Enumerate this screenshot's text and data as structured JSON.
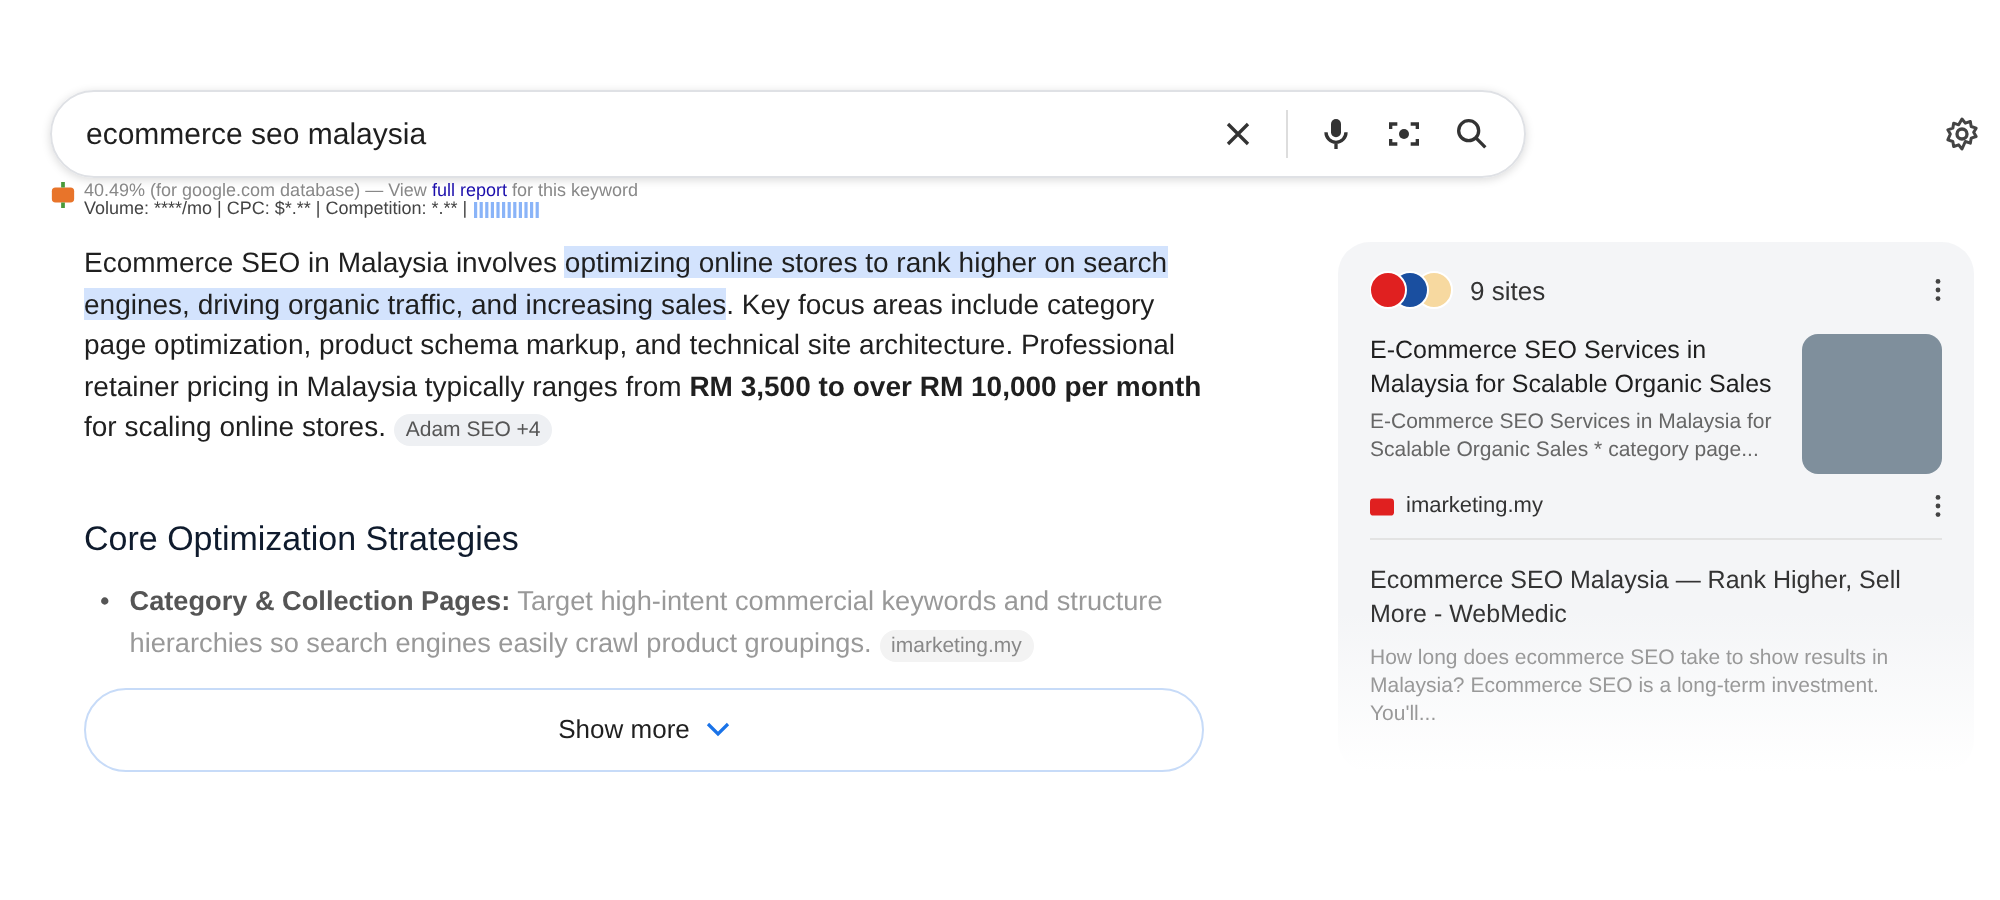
{
  "search": {
    "value": "ecommerce seo malaysia"
  },
  "seo_bar": {
    "line_1": "40.49% (for google.com database) — View **full report** for this keyword",
    "line_2": "Volume: ****/mo | CPC: $*.** | Competition: *.** |"
  },
  "overview": {
    "paragraph": [
      {
        "text": "Ecommerce SEO in Malaysia involves ",
        "highlighted": false
      },
      {
        "text": "optimizing online stores to rank higher on search engines, driving organic traffic, and increasing sales",
        "highlighted": true
      },
      {
        "text": ". Key focus areas include category page optimization, product schema markup, and technical site architecture. Professional retainer pricing in Malaysia typically ranges from **RM 3,500 to over RM 10,000 per month** for scaling online stores.",
        "highlighted": false
      }
    ],
    "source_chip": "Adam SEO +4",
    "heading": "Core Optimization Strategies",
    "bullets": [
      {
        "marker": "•",
        "title": "Category & Collection Pages:",
        "text": "Target high-intent commercial keywords and structure hierarchies so search engines easily crawl product groupings.",
        "chip": "imarketing.my"
      }
    ],
    "show_more": "Show more"
  },
  "sources": {
    "count": "9 sites",
    "items": [
      {
        "title": "E-Commerce SEO Services in Malaysia for Scalable Organic Sales",
        "snippet": "E-Commerce SEO Services in Malaysia for Scalable Organic Sales * category page...",
        "site": "imarketing.my"
      },
      {
        "title": "Ecommerce SEO Malaysia — Rank Higher, Sell More - WebMedic",
        "snippet": "How long does ecommerce SEO take to show results in Malaysia? Ecommerce SEO is a long-term investment. You'll..."
      }
    ]
  }
}
